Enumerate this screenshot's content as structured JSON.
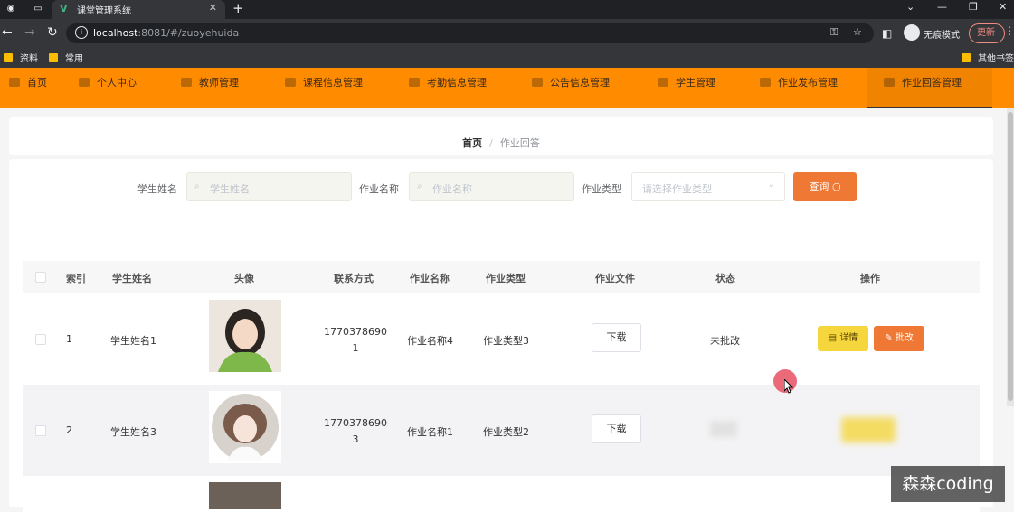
{
  "browser": {
    "tab_title": "课堂管理系统",
    "url_host": "localhost",
    "url_rest": ":8081/#/zuoyehuida",
    "incognito_label": "无痕模式",
    "update_label": "更新",
    "bookmarks": [
      "资料",
      "常用"
    ],
    "other_bookmarks": "其他书签"
  },
  "menu": {
    "items": [
      {
        "label": "首页",
        "icon": "home-icon"
      },
      {
        "label": "个人中心",
        "icon": "user-icon"
      },
      {
        "label": "教师管理",
        "icon": "teacher-icon"
      },
      {
        "label": "课程信息管理",
        "icon": "course-icon"
      },
      {
        "label": "考勤信息管理",
        "icon": "attendance-icon"
      },
      {
        "label": "公告信息管理",
        "icon": "notice-icon"
      },
      {
        "label": "学生管理",
        "icon": "student-icon"
      },
      {
        "label": "作业发布管理",
        "icon": "homework-publish-icon"
      },
      {
        "label": "作业回答管理",
        "icon": "homework-answer-icon"
      }
    ],
    "active": "作业回答管理"
  },
  "breadcrumb": {
    "home": "首页",
    "separator": "/",
    "current": "作业回答"
  },
  "search": {
    "student_name_label": "学生姓名",
    "student_name_placeholder": "学生姓名",
    "homework_name_label": "作业名称",
    "homework_name_placeholder": "作业名称",
    "homework_type_label": "作业类型",
    "homework_type_placeholder": "请选择作业类型",
    "query_button": "查询"
  },
  "table": {
    "headers": {
      "index": "索引",
      "student_name": "学生姓名",
      "avatar": "头像",
      "contact": "联系方式",
      "homework_name": "作业名称",
      "homework_type": "作业类型",
      "homework_file": "作业文件",
      "status": "状态",
      "actions": "操作"
    },
    "rows": [
      {
        "index": "1",
        "student_name": "学生姓名1",
        "contact_line1": "1770378690",
        "contact_line2": "1",
        "homework_name": "作业名称4",
        "homework_type": "作业类型3",
        "download": "下载",
        "status": "未批改",
        "detail": "详情",
        "review": "批改"
      },
      {
        "index": "2",
        "student_name": "学生姓名3",
        "contact_line1": "1770378690",
        "contact_line2": "3",
        "homework_name": "作业名称1",
        "homework_type": "作业类型2",
        "download": "下载",
        "status": "",
        "detail": "",
        "review": ""
      }
    ]
  },
  "watermark": "森森coding",
  "colors": {
    "accent": "#ff8b00",
    "query": "#f07835",
    "detail": "#f5d63d"
  }
}
